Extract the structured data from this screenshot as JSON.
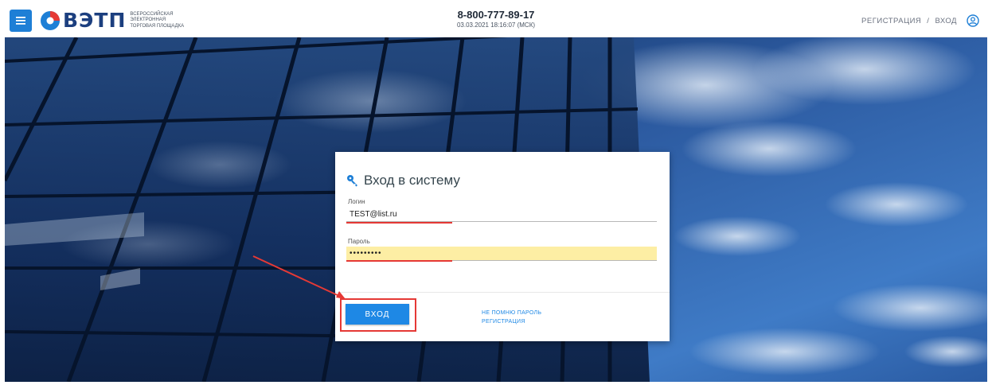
{
  "header": {
    "logo_text": "ВЭТП",
    "logo_subtitle": [
      "ВСЕРОССИЙСКАЯ",
      "ЭЛЕКТРОННАЯ",
      "ТОРГОВАЯ ПЛОЩАДКА"
    ],
    "phone": "8-800-777-89-17",
    "datetime": "03.03.2021 18:16:07 (МСК)",
    "register_link": "РЕГИСТРАЦИЯ",
    "separator": "/",
    "login_link": "ВХОД",
    "menu_icon": "hamburger-menu-icon",
    "user_icon": "user-circle-icon"
  },
  "login_form": {
    "title": "Вход в систему",
    "title_icon": "key-icon",
    "login_label": "Логин",
    "login_value": "TEST@list.ru",
    "password_label": "Пароль",
    "password_value": "•••••••••",
    "submit_label": "ВХОД",
    "forgot_password": "НЕ ПОМНЮ ПАРОЛЬ",
    "register": "РЕГИСТРАЦИЯ"
  },
  "colors": {
    "accent_blue": "#1e88e5",
    "logo_navy": "#1c3f7f",
    "annotation_red": "#e53935",
    "autofill_yellow": "#fdeea4"
  }
}
